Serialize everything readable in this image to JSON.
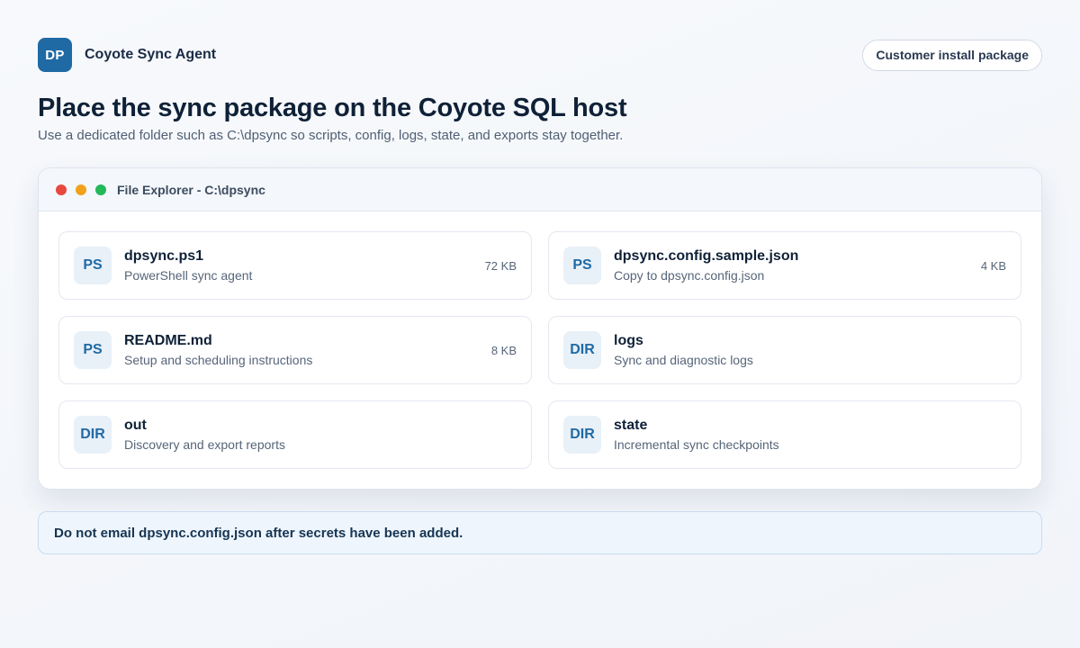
{
  "header": {
    "logo_text": "DP",
    "app_name": "Coyote Sync Agent",
    "package_button": "Customer install package"
  },
  "main": {
    "title": "Place the sync package on the Coyote SQL host",
    "subtitle": "Use a dedicated folder such as C:\\dpsync so scripts, config, logs, state, and exports stay together."
  },
  "window": {
    "title": "File Explorer - C:\\dpsync",
    "items": [
      {
        "badge": "PS",
        "name": "dpsync.ps1",
        "description": "PowerShell sync agent",
        "size": "72 KB"
      },
      {
        "badge": "PS",
        "name": "dpsync.config.sample.json",
        "description": "Copy to dpsync.config.json",
        "size": "4 KB"
      },
      {
        "badge": "PS",
        "name": "README.md",
        "description": "Setup and scheduling instructions",
        "size": "8 KB"
      },
      {
        "badge": "DIR",
        "name": "logs",
        "description": "Sync and diagnostic logs",
        "size": ""
      },
      {
        "badge": "DIR",
        "name": "out",
        "description": "Discovery and export reports",
        "size": ""
      },
      {
        "badge": "DIR",
        "name": "state",
        "description": "Incremental sync checkpoints",
        "size": ""
      }
    ]
  },
  "notice": {
    "text": "Do not email dpsync.config.json after secrets have been added."
  },
  "colors": {
    "accent": "#1f6aa5",
    "close": "#e7483f",
    "minimize": "#f1a21a",
    "maximize": "#23b85a"
  }
}
